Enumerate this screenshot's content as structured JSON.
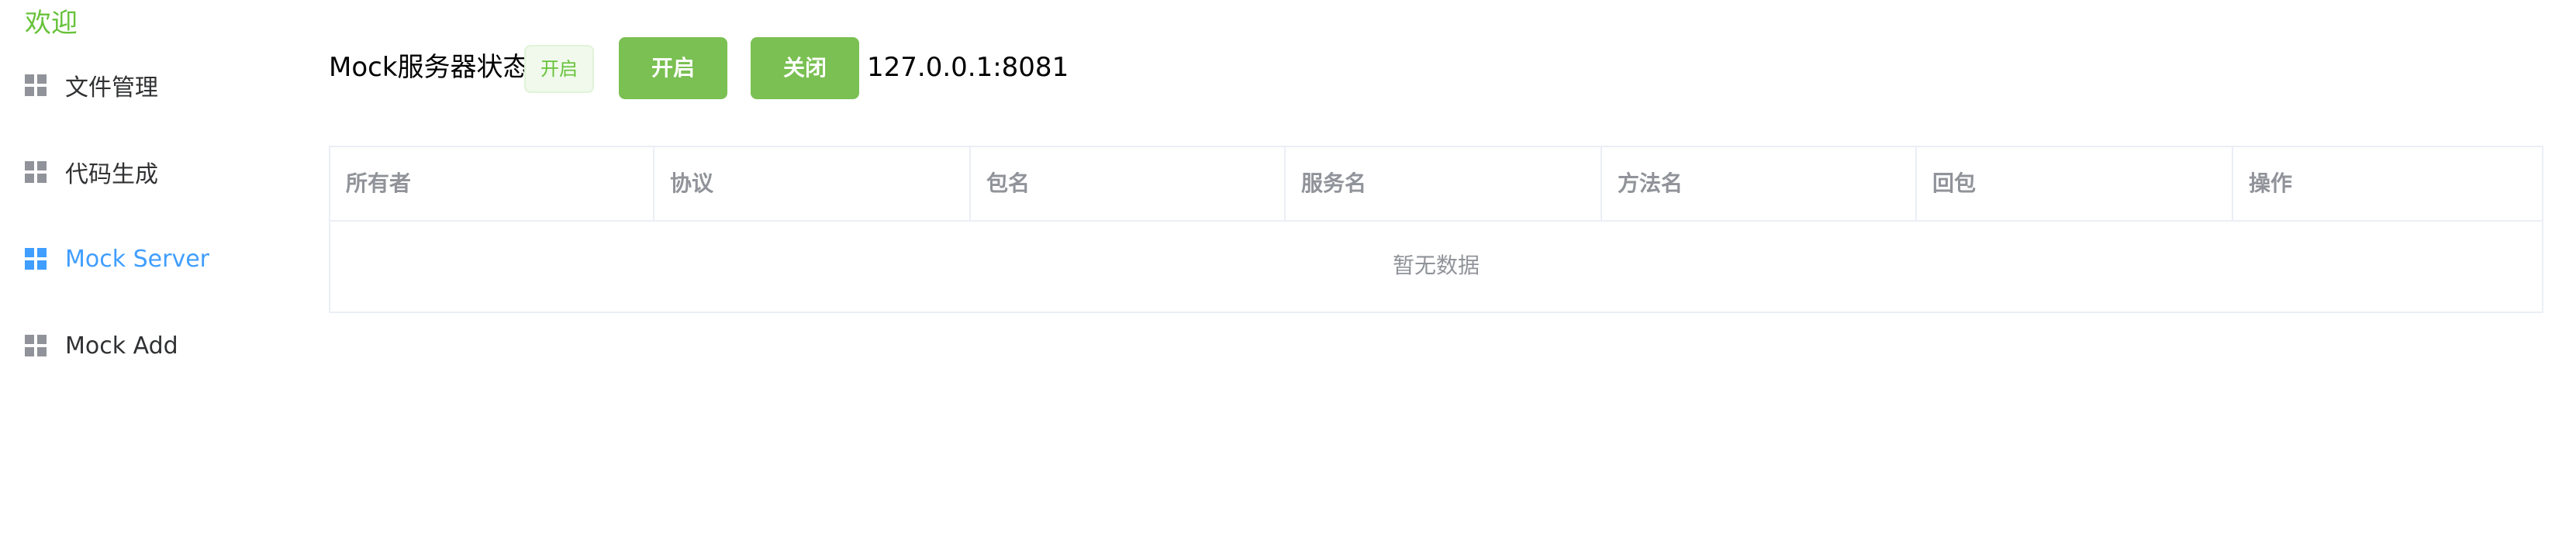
{
  "sidebar": {
    "welcome": "欢迎",
    "items": [
      {
        "label": "文件管理",
        "icon": "grid-icon",
        "active": false
      },
      {
        "label": "代码生成",
        "icon": "grid-icon",
        "active": false
      },
      {
        "label": "Mock Server",
        "icon": "grid-icon",
        "active": true
      },
      {
        "label": "Mock Add",
        "icon": "grid-icon",
        "active": false
      }
    ]
  },
  "header": {
    "status_label": "Mock服务器状态",
    "status_tag": "开启",
    "open_button": "开启",
    "close_button": "关闭",
    "address": "127.0.0.1:8081"
  },
  "table": {
    "columns": [
      "所有者",
      "协议",
      "包名",
      "服务名",
      "方法名",
      "回包",
      "操作"
    ],
    "rows": [],
    "empty_text": "暂无数据"
  },
  "colors": {
    "accent_green": "#67c23a",
    "button_green": "#7ac052",
    "active_blue": "#409eff",
    "muted_text": "#909399",
    "border": "#ebeef5"
  }
}
